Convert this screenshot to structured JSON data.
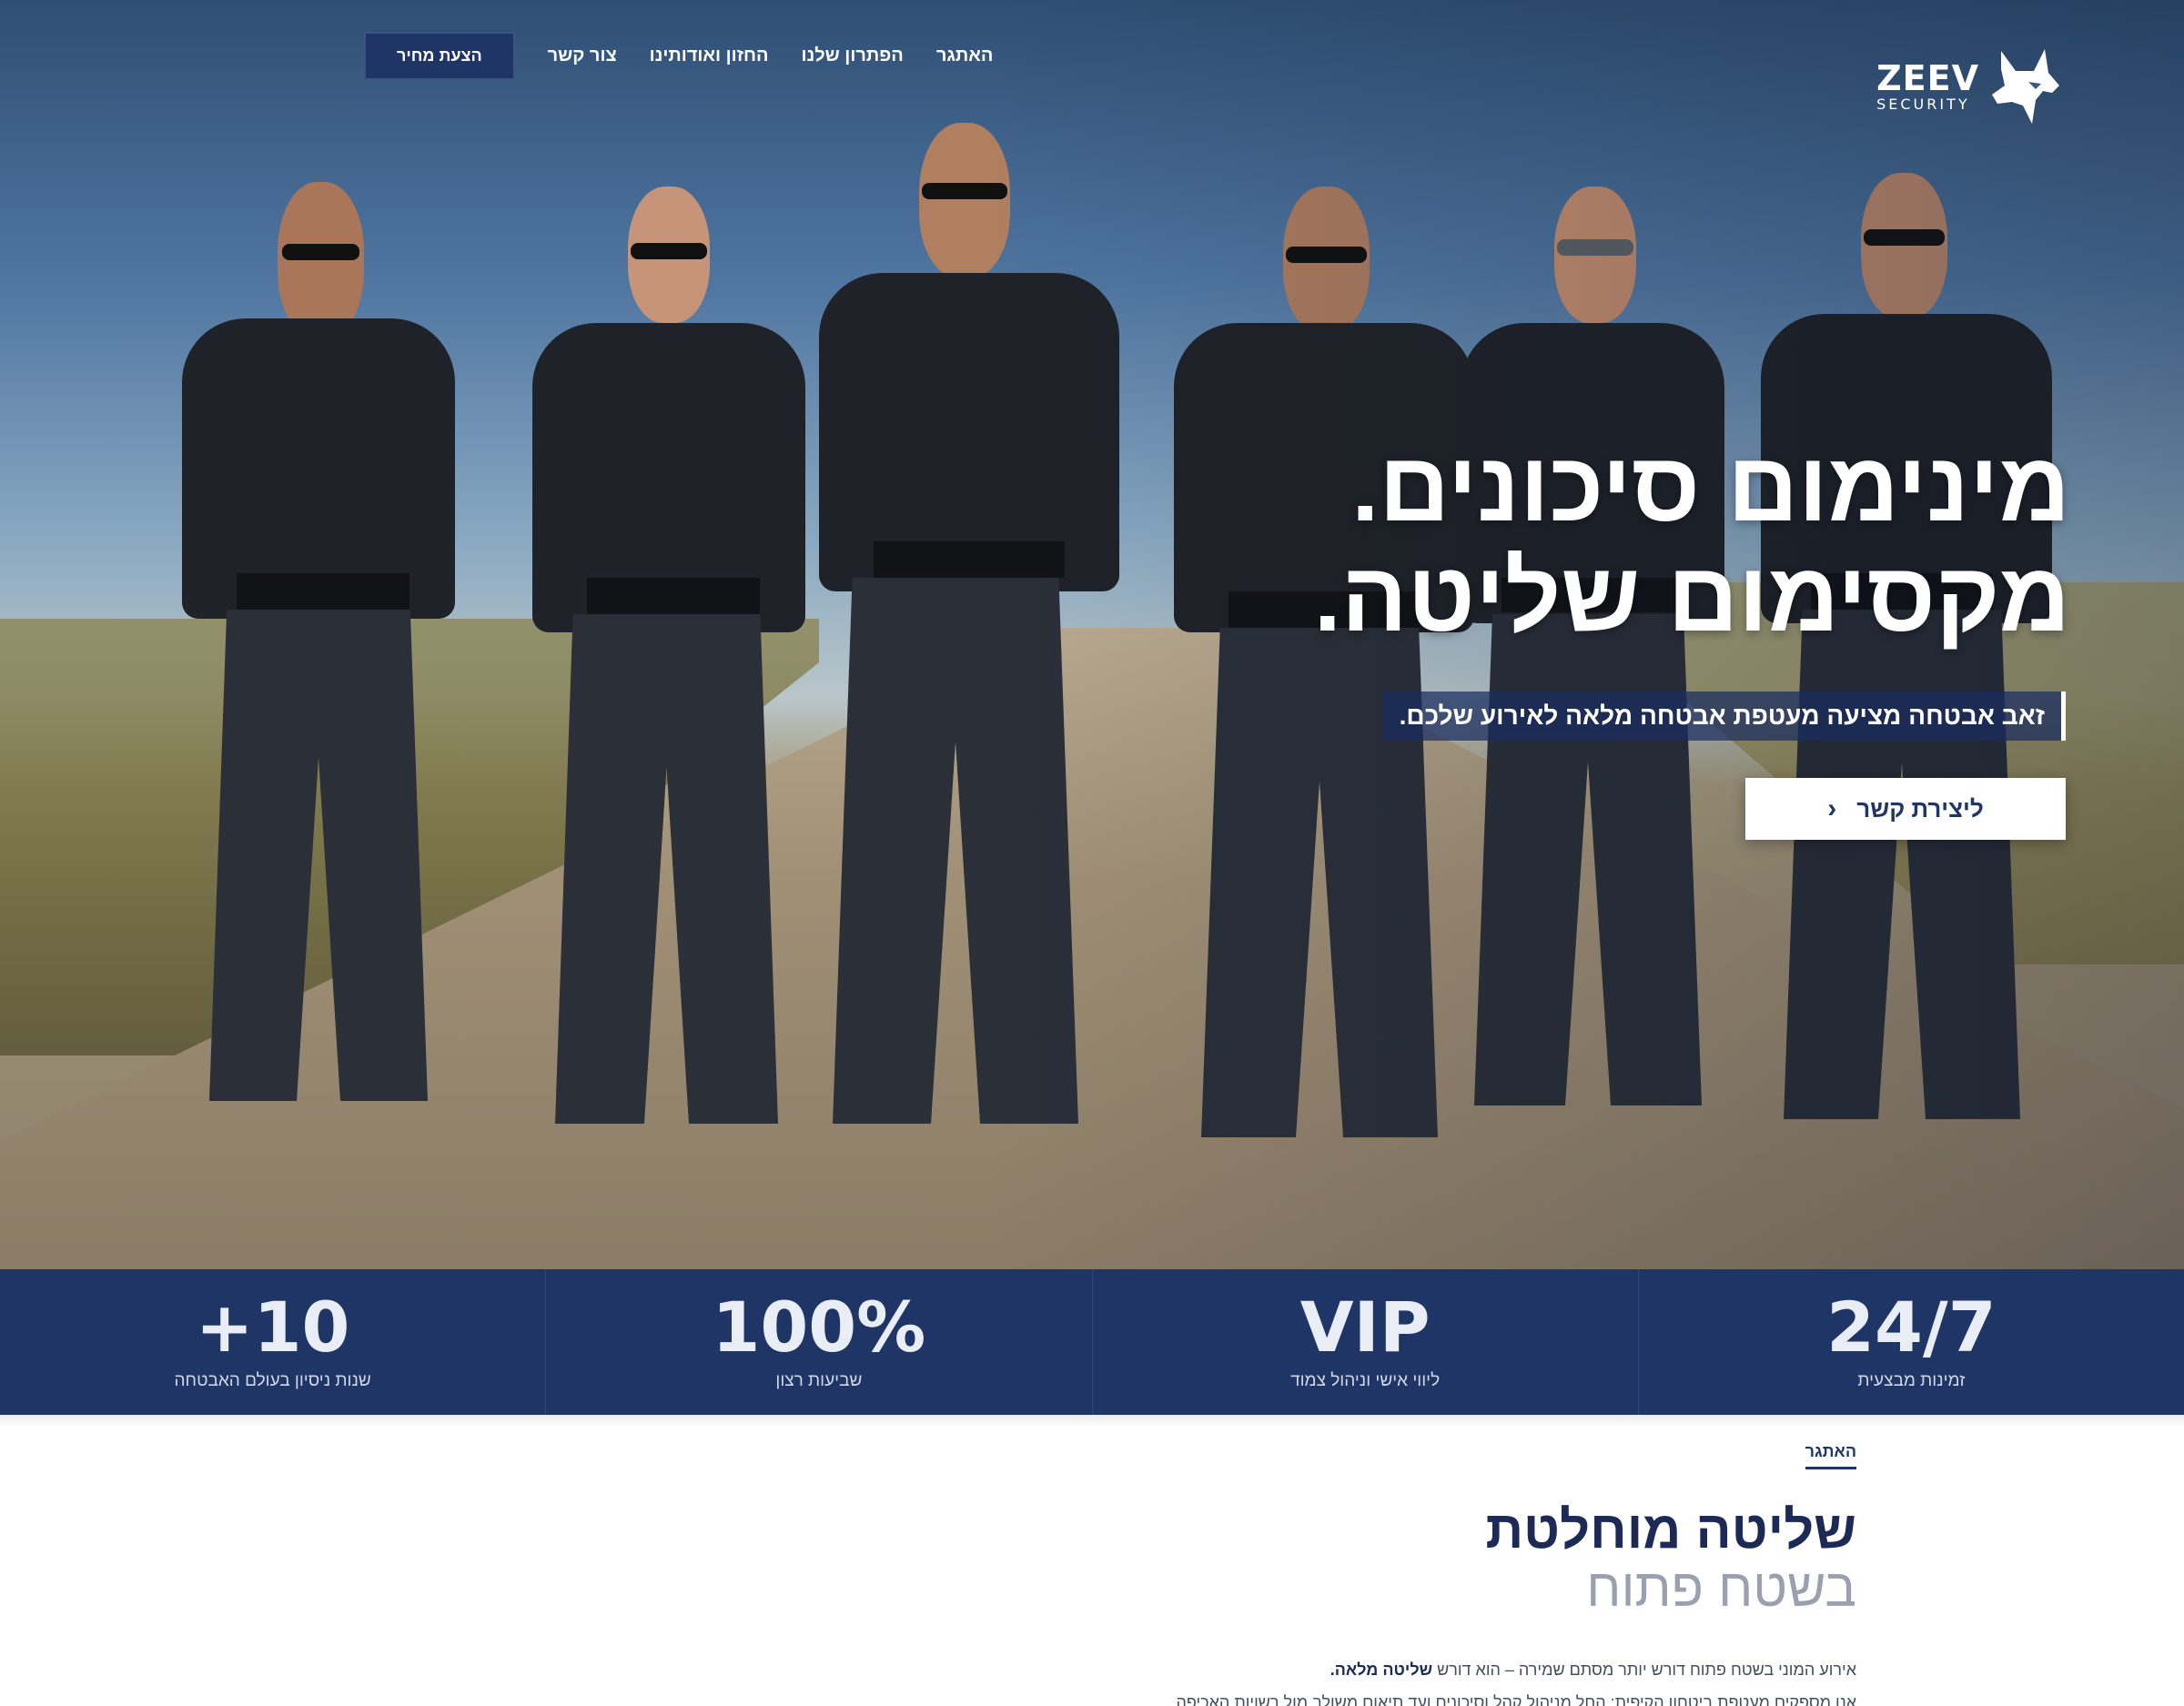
{
  "brand": {
    "name": "ZEEV",
    "tagline": "SECURITY"
  },
  "nav": {
    "items": [
      "האתגר",
      "הפתרון שלנו",
      "החזון ואודותינו",
      "צור קשר"
    ],
    "cta": "הצעת מחיר"
  },
  "hero": {
    "title_line1": "מינימום סיכונים.",
    "title_line2": "מקסימום שליטה.",
    "subtitle": "זאב אבטחה מציעה מעטפת אבטחה מלאה לאירוע שלכם.",
    "cta": "ליצירת קשר",
    "cta_icon": "chevron-left-icon"
  },
  "stats": [
    {
      "value": "24/7",
      "label": "זמינות מבצעית"
    },
    {
      "value": "VIP",
      "label": "ליווי אישי וניהול צמוד"
    },
    {
      "value": "100%",
      "label": "שביעות רצון"
    },
    {
      "value": "+10",
      "label": "שנות ניסיון בעולם האבטחה"
    }
  ],
  "about": {
    "eyebrow": "האתגר",
    "title_line1": "שליטה מוחלטת",
    "title_line2": "בשטח פתוח",
    "text_line1_plain": "אירוע המוני בשטח פתוח דורש יותר מסתם שמירה – הוא דורש ",
    "text_line1_bold": "שליטה מלאה.",
    "text_line2": "אנו מספקים מעטפת ביטחון הקיפית: החל מניהול קהל וסיכונים ועד תיאום משולב מול רשויות האכיפה."
  },
  "colors": {
    "navy": "#1f3565",
    "white": "#ffffff",
    "muted_title": "#9aa0ad"
  }
}
